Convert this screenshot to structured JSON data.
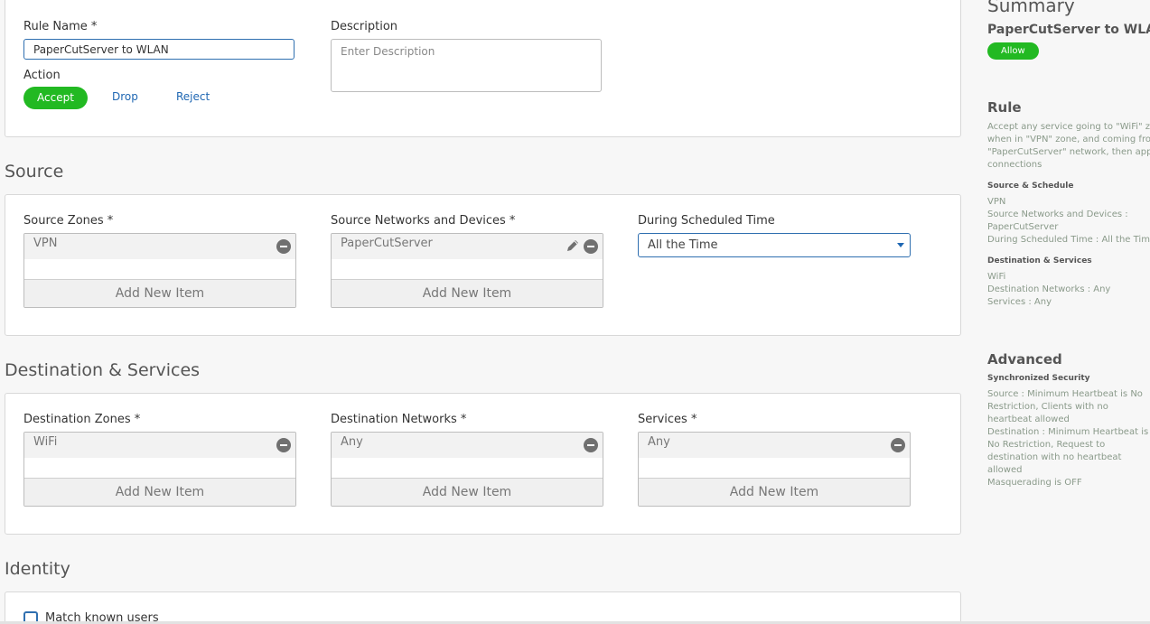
{
  "rule": {
    "name_label": "Rule Name *",
    "name_value": "PaperCutServer to WLAN",
    "description_label": "Description",
    "description_placeholder": "Enter Description",
    "action_label": "Action",
    "actions": [
      "Accept",
      "Drop",
      "Reject"
    ],
    "selected_action": "Accept"
  },
  "source": {
    "title": "Source",
    "zones_label": "Source Zones *",
    "zones": [
      "VPN"
    ],
    "networks_label": "Source Networks and Devices *",
    "networks": [
      "PaperCutServer"
    ],
    "schedule_label": "During Scheduled Time",
    "schedule_value": "All the Time",
    "add_new": "Add New Item"
  },
  "destination": {
    "title": "Destination & Services",
    "zones_label": "Destination Zones *",
    "zones": [
      "WiFi"
    ],
    "networks_label": "Destination Networks *",
    "networks": [
      "Any"
    ],
    "services_label": "Services *",
    "services": [
      "Any"
    ],
    "add_new": "Add New Item"
  },
  "identity": {
    "title": "Identity",
    "match_known_users": "Match known users"
  },
  "summary": {
    "title": "Summary",
    "rule_name": "PaperCutServer to WLAN",
    "badge": "Allow",
    "rule_heading": "Rule",
    "rule_lines": [
      "Accept any service going to \"WiFi\" zone,",
      "when in \"VPN\" zone, and coming from",
      "\"PaperCutServer\" network, then apply lo",
      "connections"
    ],
    "source_schedule_heading": "Source & Schedule",
    "source_lines": [
      "VPN",
      "Source Networks and Devices :",
      "PaperCutServer",
      "During Scheduled Time : All the Time"
    ],
    "dest_heading": "Destination & Services",
    "dest_lines": [
      "WiFi",
      "Destination Networks : Any",
      "Services : Any"
    ],
    "advanced_heading": "Advanced",
    "sync_heading": "Synchronized Security",
    "sync_source": "Source : Minimum Heartbeat is No Restriction, Clients with no heartbeat allowed",
    "sync_dest": "Destination : Minimum Heartbeat is No Restriction, Request to destination with no heartbeat allowed",
    "masquerading": "Masquerading is OFF"
  },
  "colors": {
    "accent_green": "#22b922",
    "link_blue": "#1f67b3",
    "focus_border": "#2f6fb0"
  }
}
